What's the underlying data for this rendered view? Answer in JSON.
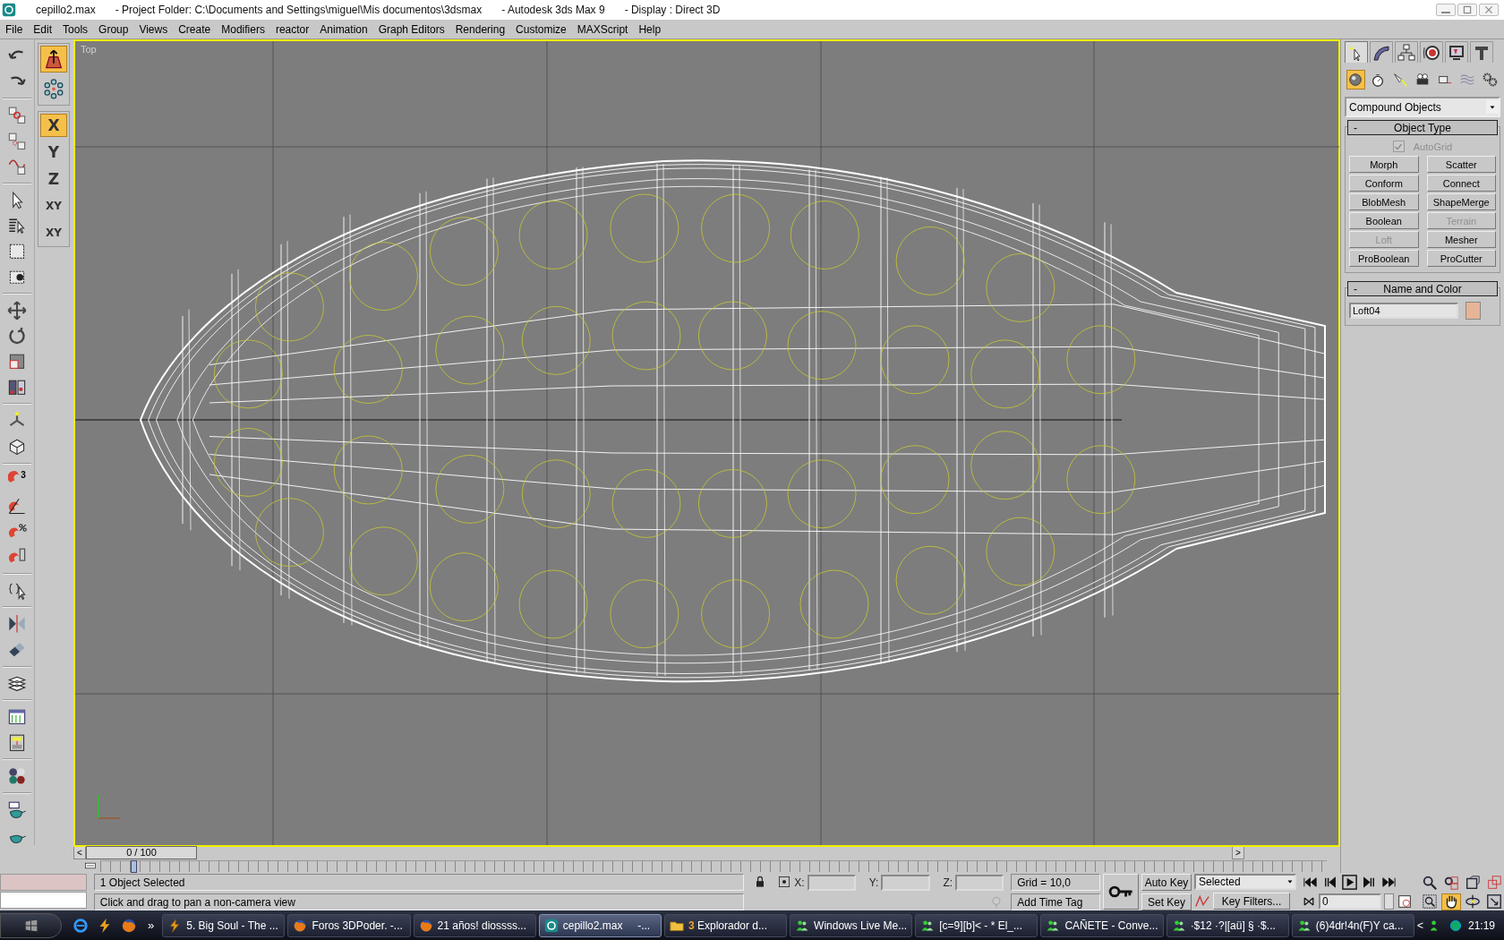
{
  "title_bar": {
    "parts": [
      "cepillo2.max",
      "- Project Folder: C:\\Documents and Settings\\miguel\\Mis documentos\\3dsmax",
      "- Autodesk 3ds Max 9",
      "- Display : Direct 3D"
    ]
  },
  "menu": [
    "File",
    "Edit",
    "Tools",
    "Group",
    "Views",
    "Create",
    "Modifiers",
    "reactor",
    "Animation",
    "Graph Editors",
    "Rendering",
    "Customize",
    "MAXScript",
    "Help"
  ],
  "snap_dimension": "3",
  "placement_modes": [
    {
      "selected": true
    },
    {
      "selected": false
    }
  ],
  "axis_constraints": [
    {
      "label": "X",
      "selected": true
    },
    {
      "label": "Y",
      "selected": false
    },
    {
      "label": "Z",
      "selected": false
    },
    {
      "label": "XY",
      "selected": false
    },
    {
      "label": "XY",
      "selected": false
    }
  ],
  "viewport": {
    "label": "Top"
  },
  "command_panel": {
    "tabs": [
      {
        "selected": true
      },
      {
        "selected": false
      },
      {
        "selected": false
      },
      {
        "selected": false
      },
      {
        "selected": false
      },
      {
        "selected": false
      }
    ],
    "categories": [
      {
        "selected": true
      },
      {
        "selected": false
      },
      {
        "selected": false
      },
      {
        "selected": false
      },
      {
        "selected": false
      },
      {
        "selected": false
      },
      {
        "selected": false
      }
    ],
    "category_dropdown": "Compound Objects",
    "object_type": {
      "collapse": "-",
      "title": "Object Type",
      "autogrid": {
        "label": "AutoGrid",
        "checked": true,
        "disabled": true
      },
      "buttons": [
        {
          "label": "Morph",
          "disabled": false
        },
        {
          "label": "Scatter",
          "disabled": false
        },
        {
          "label": "Conform",
          "disabled": false
        },
        {
          "label": "Connect",
          "disabled": false
        },
        {
          "label": "BlobMesh",
          "disabled": false
        },
        {
          "label": "ShapeMerge",
          "disabled": false
        },
        {
          "label": "Boolean",
          "disabled": false
        },
        {
          "label": "Terrain",
          "disabled": true
        },
        {
          "label": "Loft",
          "disabled": true
        },
        {
          "label": "Mesher",
          "disabled": false
        },
        {
          "label": "ProBoolean",
          "disabled": false
        },
        {
          "label": "ProCutter",
          "disabled": false
        }
      ]
    },
    "name_and_color": {
      "collapse": "-",
      "title": "Name and Color",
      "name": "Loft04",
      "color": "#e6b496"
    }
  },
  "time_slider": {
    "prev": "<",
    "position": "0 / 100",
    "level": 0,
    "next": ">"
  },
  "status_bar": {
    "selection": "1 Object Selected",
    "prompt": "Click and drag to pan a non-camera view",
    "x_label": "X:",
    "y_label": "Y:",
    "z_label": "Z:",
    "grid": "Grid = 10,0",
    "time_tag": "Add Time Tag",
    "auto_key": "Auto Key",
    "set_key": "Set Key",
    "key_mode": "Selected",
    "key_filters": "Key Filters...",
    "frame": "0"
  },
  "nav_tools": [
    {
      "selected": false
    },
    {
      "selected": false
    },
    {
      "selected": false
    },
    {
      "selected": false
    },
    {
      "selected": false
    },
    {
      "selected": true
    },
    {
      "selected": false
    },
    {
      "selected": false
    }
  ],
  "taskbar": {
    "more": "»",
    "tasks": [
      {
        "kind": "media",
        "label": "5. Big Soul - The ...",
        "active": false
      },
      {
        "kind": "browser",
        "label": "Foros 3DPoder. -...",
        "active": false
      },
      {
        "kind": "browser",
        "label": "21 años! diossss...",
        "active": false
      },
      {
        "kind": "max",
        "label": "cepillo2.max     -...",
        "active": true
      },
      {
        "kind": "folder",
        "label": "**3** Explorador d...",
        "active": false
      },
      {
        "kind": "messenger",
        "label": "Windows Live Me...",
        "active": false
      },
      {
        "kind": "messenger",
        "label": "[c=9][b]< - * El_...",
        "active": false
      },
      {
        "kind": "messenger",
        "label": "CAÑETE - Conve...",
        "active": false
      },
      {
        "kind": "messenger",
        "label": "·$12 ·?|[aü] § ·$...",
        "active": false
      },
      {
        "kind": "messenger",
        "label": "(6)4dr!4n(F)Y ca...",
        "active": false
      }
    ],
    "tray_toggle": "<",
    "clock": "21:19"
  }
}
